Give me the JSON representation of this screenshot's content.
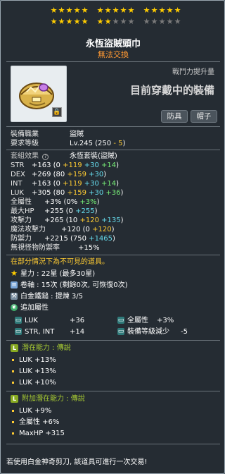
{
  "stars": {
    "filled": 22,
    "total": 30,
    "icon": "star-icon"
  },
  "item": {
    "name": "永恆盜賊頭巾",
    "trade": "無法交換"
  },
  "combat": {
    "label": "戰鬥力提升量",
    "status": "目前穿戴中的裝備"
  },
  "tags": [
    "防具",
    "帽子"
  ],
  "requirements": [
    {
      "label": "裝備職業",
      "value": "盜賊"
    },
    {
      "label": "要求等級",
      "value_main": "Lv.245 (250 ",
      "value_minus": "- 5",
      "value_end": ")"
    }
  ],
  "set_effect": {
    "label": "套組效果",
    "value": "永恆套裝(盜賊)"
  },
  "stats": [
    {
      "name": "STR",
      "total": "+163",
      "base": "(0 ",
      "flame": "+119",
      "star": "+30",
      "extra": "+14",
      "extra_color": "#77ee77",
      "close": ")"
    },
    {
      "name": "DEX",
      "total": "+269",
      "base": "(80 ",
      "flame": "+159",
      "star": "+30",
      "extra": "",
      "extra_color": "",
      "close": ")"
    },
    {
      "name": "INT",
      "total": "+163",
      "base": "(0 ",
      "flame": "+119",
      "star": "+30",
      "extra": "+14",
      "extra_color": "#77ee77",
      "close": ")"
    },
    {
      "name": "LUK",
      "total": "+305",
      "base": "(80 ",
      "flame": "+159",
      "star": "+30",
      "extra": "+36",
      "extra_color": "#77ee77",
      "close": ")"
    }
  ],
  "allstat": {
    "name": "全屬性",
    "total": "+3%",
    "base": "(0% ",
    "extra": "+3%",
    "close": ")"
  },
  "maxhp": {
    "name": "最大HP",
    "total": "+255",
    "base": "(0 ",
    "star": "+255",
    "close": ")"
  },
  "atk": {
    "name": "攻擊力",
    "total": "+265",
    "base": "(10 ",
    "flame": "+120",
    "star": "+135",
    "close": ")"
  },
  "matk": {
    "name": "魔法攻擊力",
    "total": "+120",
    "base": "(0 ",
    "flame": "+120",
    "close": ")"
  },
  "def": {
    "name": "防禦力",
    "total": "+2215",
    "base": "(750 ",
    "star": "+1465",
    "close": ")"
  },
  "ignore": {
    "name": "無視怪物防禦率",
    "value": "+15%"
  },
  "invisible_note": "在部分情況下為不可見的道具。",
  "star_line": "星力 : 22星 (最多30星)",
  "scroll_line": "卷軸 : 15次 (剩餘0次, 可恢復0次)",
  "platinum_line": "白金鐵鎚 : 提煉 3/5",
  "addl": {
    "title": "追加屬性",
    "items": [
      {
        "name": "LUK",
        "value": "+36"
      },
      {
        "name": "全屬性",
        "value": "+3%"
      },
      {
        "name": "STR, INT",
        "value": "+14"
      },
      {
        "name": "裝備等級減少",
        "value": "-5"
      }
    ]
  },
  "potential": {
    "badge": "L",
    "title": "潛在能力 : 傳說",
    "lines": [
      "LUK +13%",
      "LUK +13%",
      "LUK +10%"
    ]
  },
  "bonus_potential": {
    "badge": "L",
    "title": "附加潛在能力 : 傳說",
    "lines": [
      "LUK +9%",
      "全屬性 +6%",
      "MaxHP +315"
    ]
  },
  "footer": "若使用白金神奇剪刀, 該道具可進行一次交易!",
  "colors": {
    "potential": "#88aa22",
    "flame": "#ffcc33",
    "star": "#66ddee",
    "add": "#c9a7ff"
  }
}
